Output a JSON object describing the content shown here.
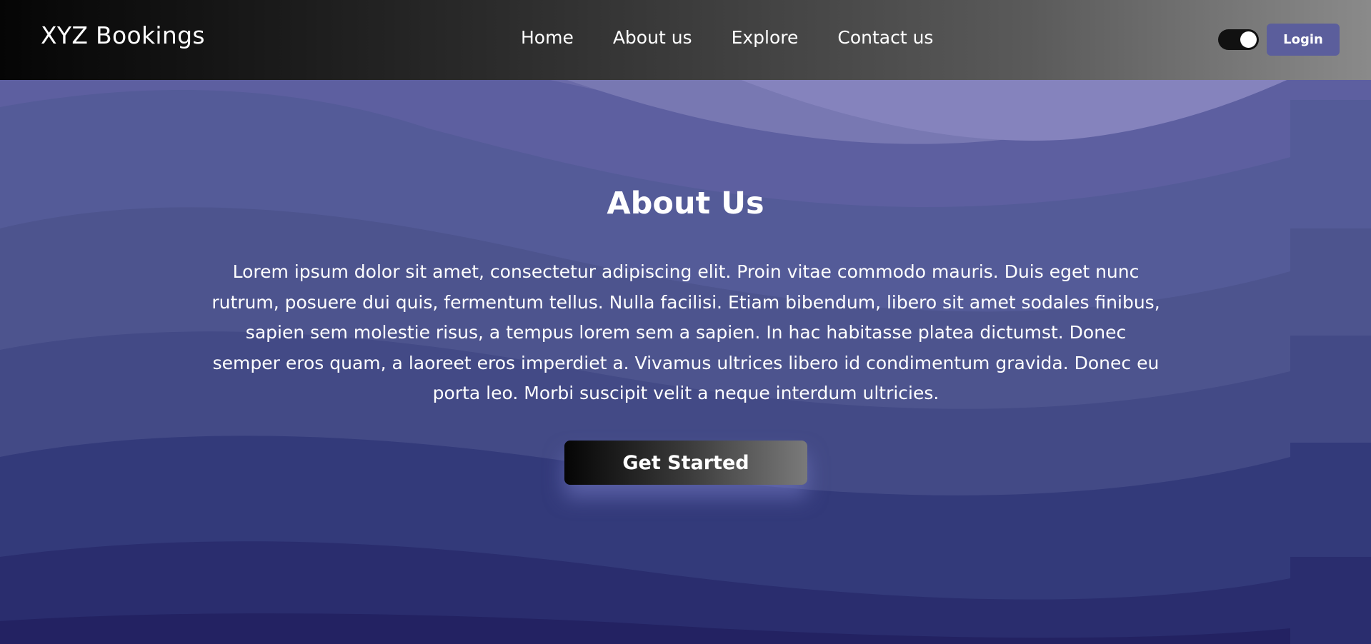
{
  "header": {
    "brand": "XYZ Bookings",
    "nav": [
      "Home",
      "About us",
      "Explore",
      "Contact us"
    ],
    "login_label": "Login",
    "theme_toggle_on": true
  },
  "hero": {
    "title": "About Us",
    "body": "Lorem ipsum dolor sit amet, consectetur adipiscing elit. Proin vitae commodo mauris. Duis eget nunc rutrum, posuere dui quis, fermentum tellus. Nulla facilisi. Etiam bibendum, libero sit amet sodales finibus, sapien sem molestie risus, a tempus lorem sem a sapien. In hac habitasse platea dictumst. Donec semper eros quam, a laoreet eros imperdiet a. Vivamus ultrices libero id condimentum gravida. Donec eu porta leo. Morbi suscipit velit a neque interdum ultricies.",
    "cta_label": "Get Started"
  },
  "colors": {
    "login_button": "#5b5e9c",
    "wave_light": "#8583bd",
    "wave_dark": "#232262"
  }
}
